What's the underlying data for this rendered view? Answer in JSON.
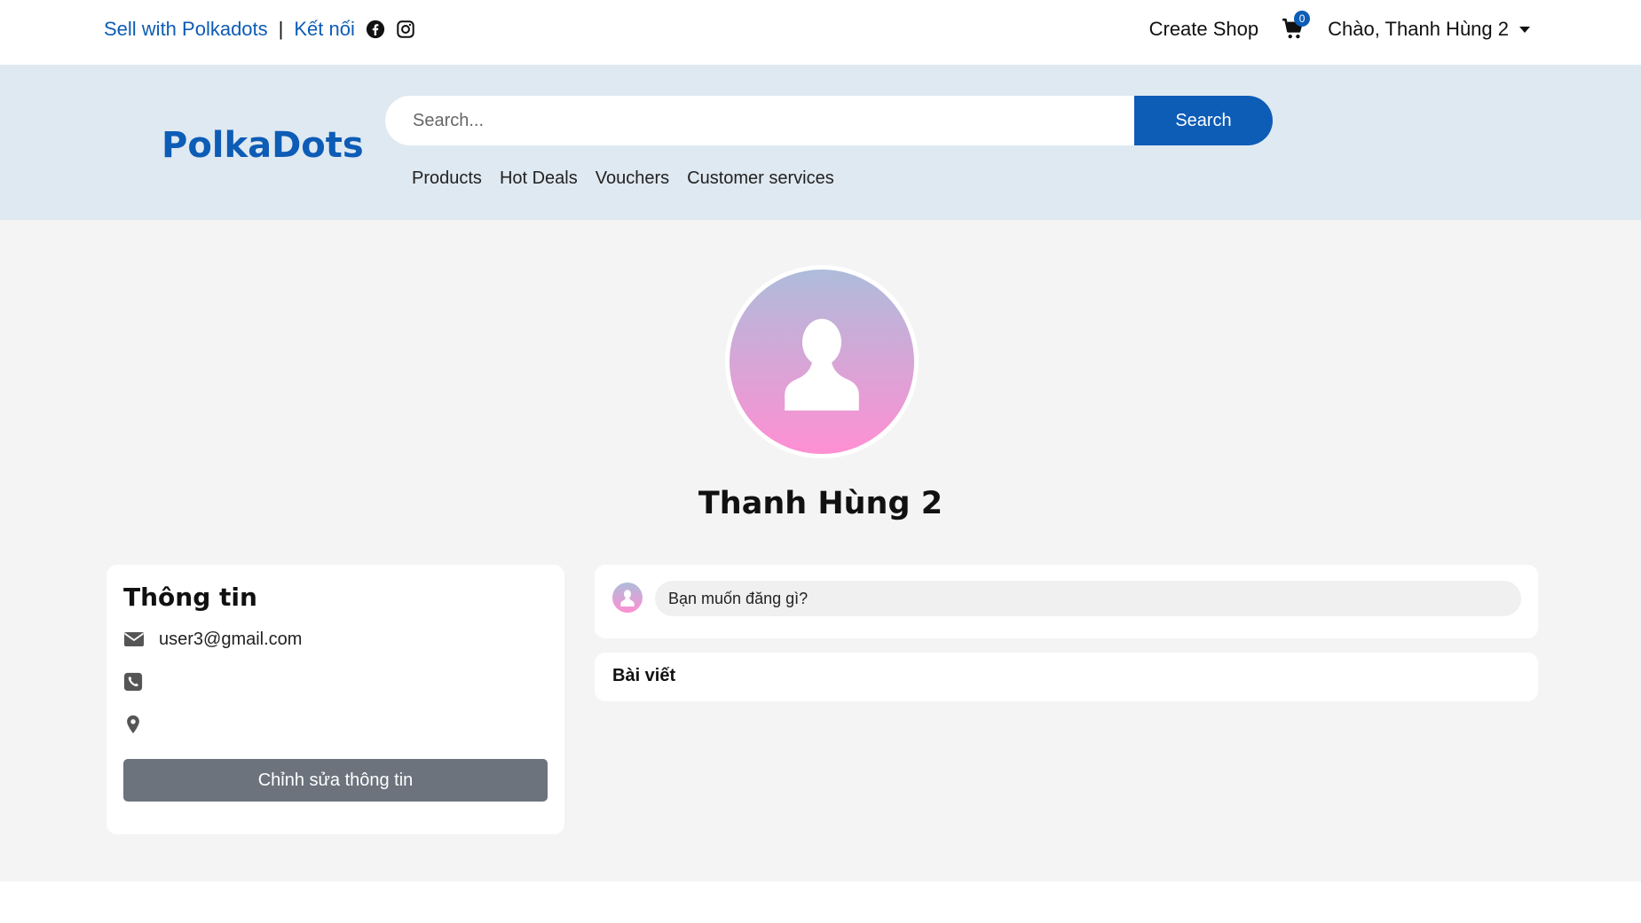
{
  "topbar": {
    "sell_link": "Sell with Polkadots",
    "separator": "|",
    "connect_link": "Kết nối",
    "social_icons": [
      "facebook-icon",
      "instagram-icon"
    ],
    "create_shop": "Create Shop",
    "cart_count": "0",
    "greeting": "Chào, Thanh Hùng 2"
  },
  "header": {
    "logo": "PolkaDots",
    "search_placeholder": "Search...",
    "search_button": "Search",
    "nav": [
      "Products",
      "Hot Deals",
      "Vouchers",
      "Customer services"
    ]
  },
  "profile": {
    "name": "Thanh Hùng 2"
  },
  "info": {
    "title": "Thông tin",
    "email": "user3@gmail.com",
    "phone": "",
    "address": "",
    "edit_button": "Chỉnh sửa thông tin"
  },
  "composer": {
    "placeholder": "Bạn muốn đăng gì?"
  },
  "posts": {
    "title": "Bài viết"
  },
  "colors": {
    "brand": "#0d5cb6",
    "header_bg": "#dfe9f1",
    "main_bg": "#f4f4f4",
    "edit_button_bg": "#6c737d"
  }
}
